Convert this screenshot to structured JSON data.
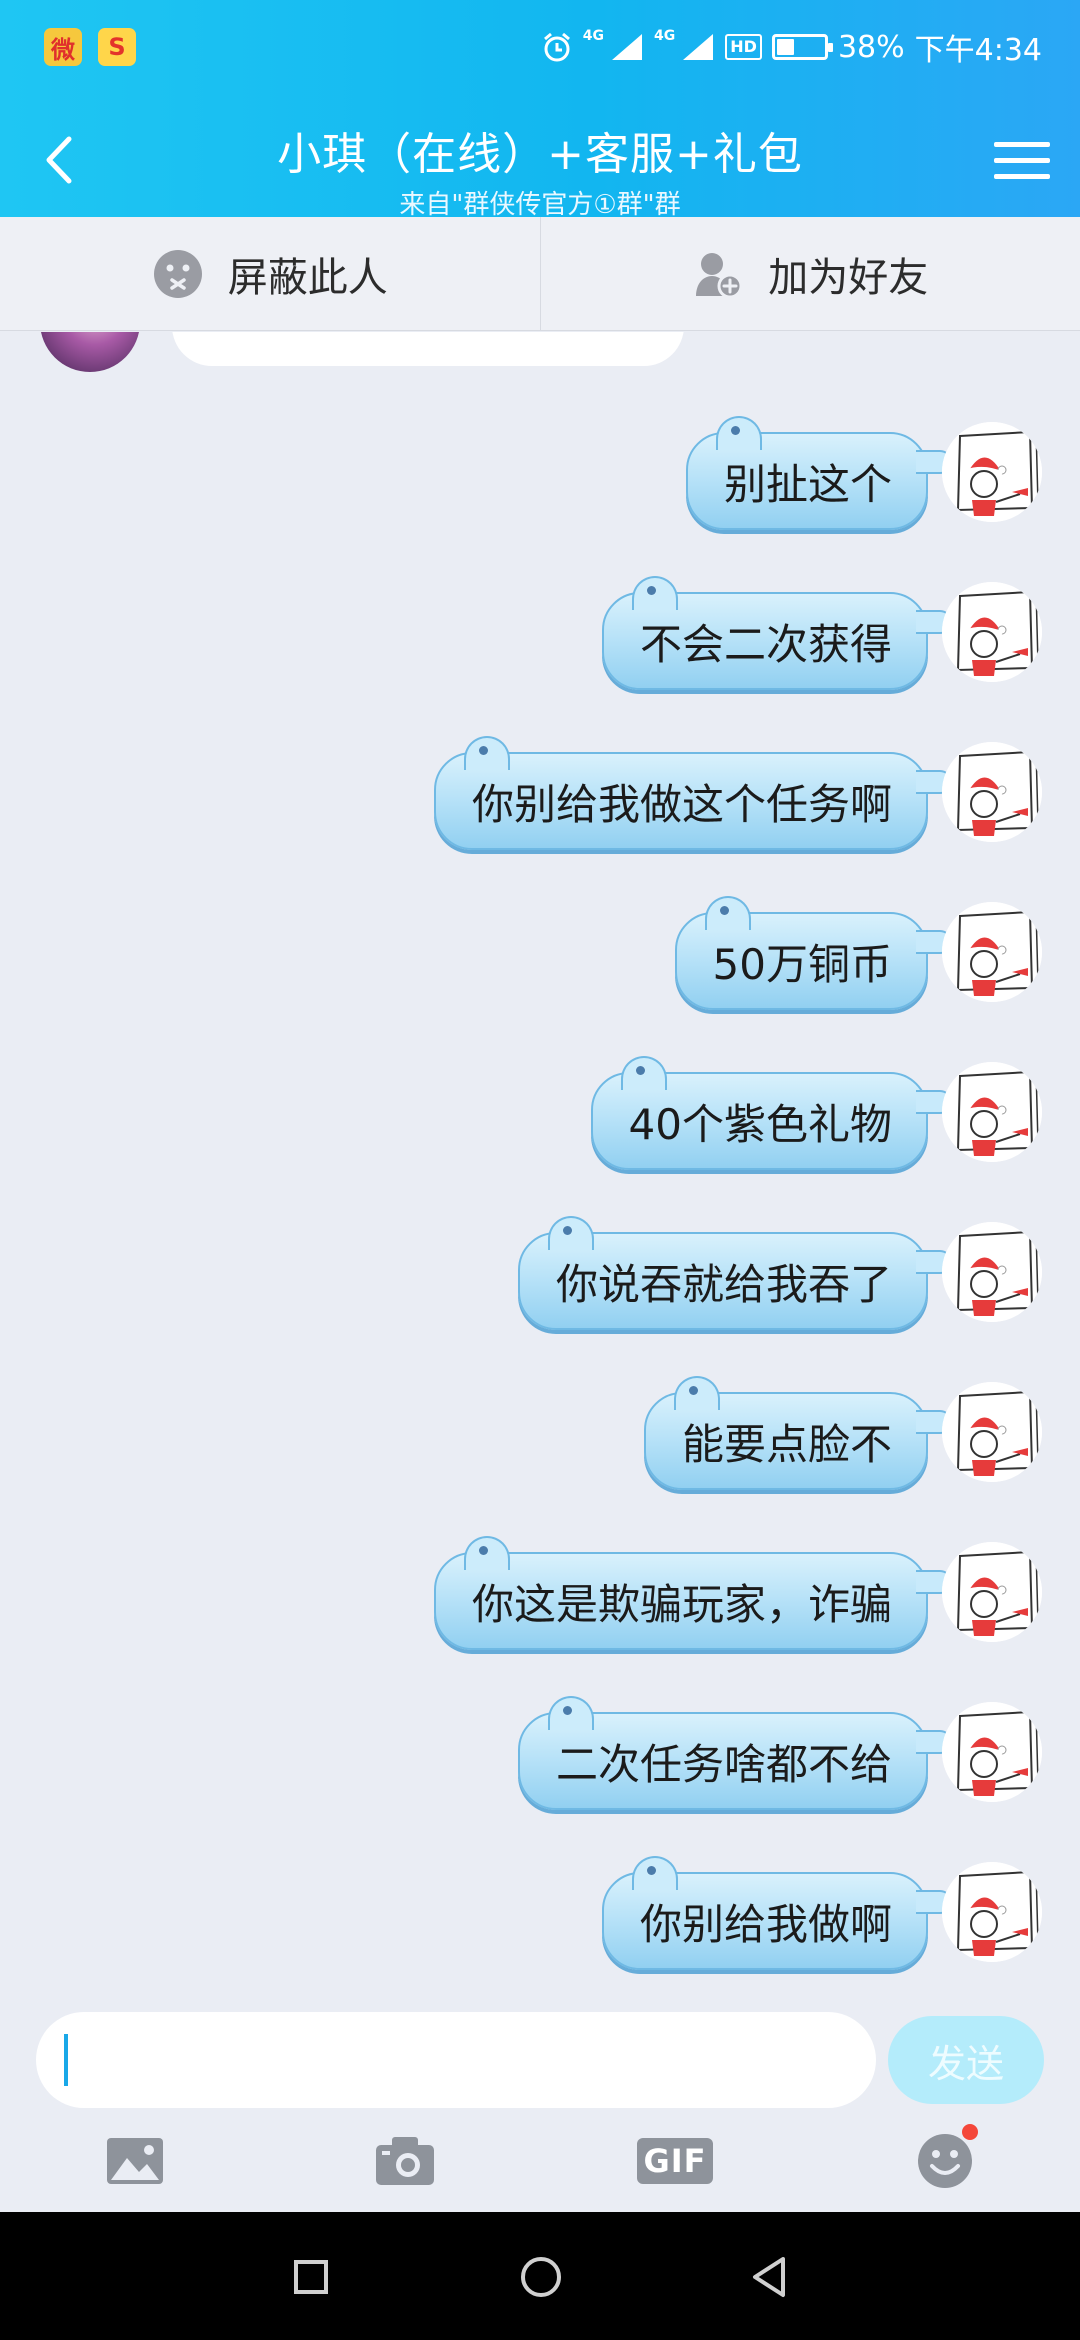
{
  "status_bar": {
    "apps": [
      "weibo-icon",
      "sohu-icon"
    ],
    "network1": "4G",
    "network2": "4G",
    "hd": "HD",
    "battery_percent": "38%",
    "battery_level": 0.38,
    "time": "下午4:34"
  },
  "header": {
    "title": "小琪（在线）+客服+礼包",
    "subtitle": "来自\"群侠传官方①群\"群"
  },
  "actions": {
    "block_label": "屏蔽此人",
    "add_friend_label": "加为好友"
  },
  "messages": [
    {
      "text": "别扯这个",
      "sender": "me"
    },
    {
      "text": "不会二次获得",
      "sender": "me"
    },
    {
      "text": "你别给我做这个任务啊",
      "sender": "me"
    },
    {
      "text": "50万铜币",
      "sender": "me"
    },
    {
      "text": "40个紫色礼物",
      "sender": "me"
    },
    {
      "text": "你说吞就给我吞了",
      "sender": "me"
    },
    {
      "text": "能要点脸不",
      "sender": "me"
    },
    {
      "text": "你这是欺骗玩家，诈骗",
      "sender": "me"
    },
    {
      "text": "二次任务啥都不给",
      "sender": "me"
    },
    {
      "text": "你别给我做啊",
      "sender": "me"
    }
  ],
  "input": {
    "value": "",
    "send_label": "发送"
  },
  "toolbar": {
    "gif_label": "GIF",
    "items": [
      "image-icon",
      "camera-icon",
      "gif-icon",
      "emoji-icon"
    ]
  },
  "colors": {
    "header_gradient_start": "#1fc6f3",
    "header_gradient_end": "#2ba7f5",
    "bubble_fill": "#b9e3f8",
    "bubble_border": "#6fb9e4",
    "send_button": "#b4ecfb",
    "background": "#eaedf4"
  }
}
